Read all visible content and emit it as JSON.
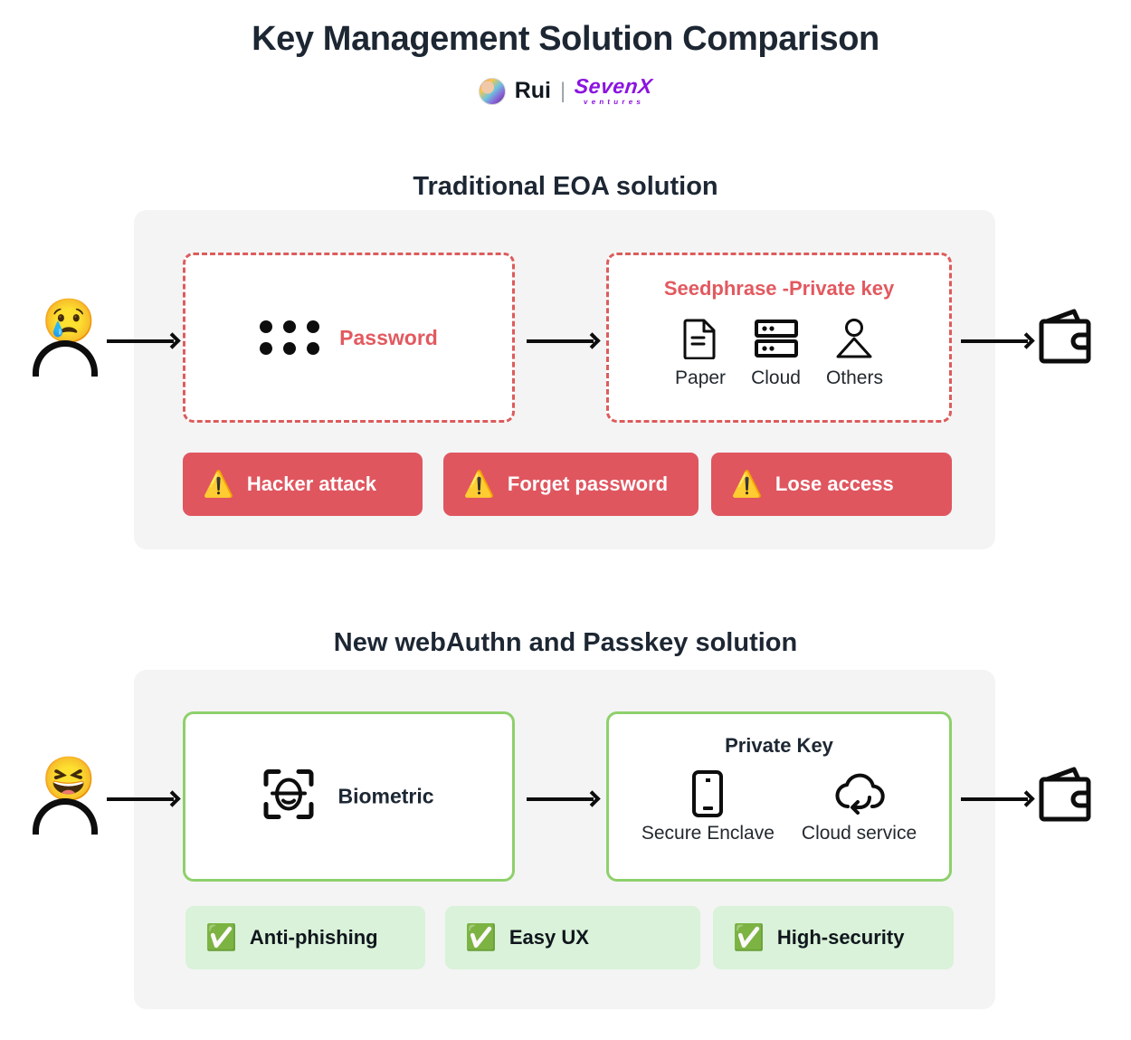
{
  "header": {
    "title": "Key Management Solution Comparison",
    "author_name": "Rui",
    "separator": "|",
    "brand_main": "SevenX",
    "brand_sub": "ventures",
    "avatar_icon": "avatar-image",
    "brand_color": "#8b14e0"
  },
  "traditional": {
    "section_title": "Traditional EOA solution",
    "actor_emoji": "😢",
    "actor_name": "sad-user",
    "password_box": {
      "label": "Password",
      "dot_count": 6,
      "border_color": "#dd5c5c"
    },
    "seed_box": {
      "heading": "Seedphrase -Private key",
      "border_color": "#dd5c5c",
      "items": [
        {
          "label": "Paper",
          "icon": "document-icon"
        },
        {
          "label": "Cloud",
          "icon": "server-stack-icon"
        },
        {
          "label": "Others",
          "icon": "person-icon"
        }
      ]
    },
    "wallet_icon": "wallet-icon",
    "badges": [
      {
        "label": "Hacker attack",
        "icon": "⚠️",
        "icon_name": "warning-triangle-icon"
      },
      {
        "label": "Forget password",
        "icon": "⚠️",
        "icon_name": "warning-triangle-icon"
      },
      {
        "label": "Lose access",
        "icon": "⚠️",
        "icon_name": "warning-triangle-icon"
      }
    ],
    "badge_color": "#e0565f"
  },
  "modern": {
    "section_title": "New webAuthn and Passkey solution",
    "actor_emoji": "😆",
    "actor_name": "happy-user",
    "biometric_box": {
      "label": "Biometric",
      "icon": "face-id-icon",
      "border_color": "#8ed06c"
    },
    "private_key_box": {
      "heading": "Private Key",
      "border_color": "#8ed06c",
      "items": [
        {
          "label": "Secure Enclave",
          "icon": "phone-icon"
        },
        {
          "label": "Cloud service",
          "icon": "cloud-sync-icon"
        }
      ]
    },
    "wallet_icon": "wallet-icon",
    "badges": [
      {
        "label": "Anti-phishing",
        "icon": "✅",
        "icon_name": "green-check-icon"
      },
      {
        "label": "Easy UX",
        "icon": "✅",
        "icon_name": "green-check-icon"
      },
      {
        "label": "High-security",
        "icon": "✅",
        "icon_name": "green-check-icon"
      }
    ],
    "badge_color": "#d9f2d9"
  }
}
